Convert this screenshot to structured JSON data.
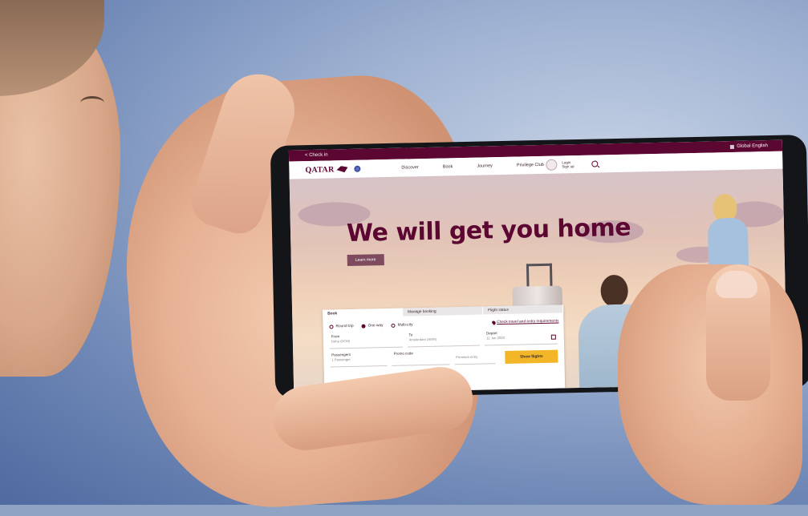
{
  "topbar": {
    "left_label": "< Check in",
    "language_label": "Global English"
  },
  "nav": {
    "logo_text": "QATAR",
    "links": [
      "Discover",
      "Book",
      "Journey",
      "Privilege Club"
    ],
    "login_line1": "Login",
    "login_line2": "Sign up"
  },
  "hero": {
    "title": "We will get you home",
    "cta_label": "Learn more"
  },
  "booking": {
    "tabs": [
      "Book",
      "Manage booking",
      "Flight status"
    ],
    "trip_types": [
      "Round trip",
      "One way",
      "Multi-city"
    ],
    "selected_trip_type": "One way",
    "requirements_link": "Check travel and entry requirements",
    "fields": {
      "from_label": "From",
      "from_value": "Doha (DOH)",
      "to_label": "To",
      "to_value": "Amsterdam (AMS)",
      "depart_label": "Depart",
      "depart_value": "11 Jun 2020",
      "passengers_label": "Passengers",
      "passengers_value": "1 Passenger",
      "promo_label": "Promo code",
      "cabin_value": "Premium entry"
    },
    "submit_label": "Show flights"
  },
  "colors": {
    "brand": "#5c0632",
    "cta": "#f2b628"
  }
}
